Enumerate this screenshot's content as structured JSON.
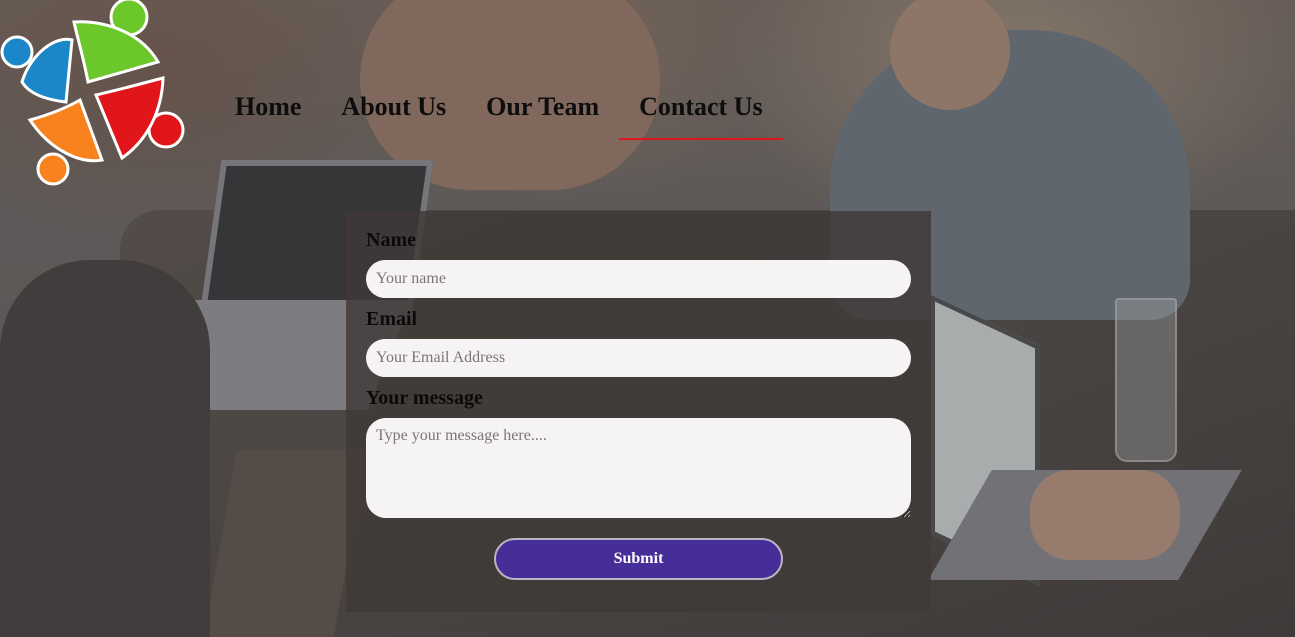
{
  "nav": {
    "items": [
      {
        "label": "Home",
        "active": false
      },
      {
        "label": "About Us",
        "active": false
      },
      {
        "label": "Our Team",
        "active": false
      },
      {
        "label": "Contact Us",
        "active": true
      }
    ],
    "active_underline_color": "#e0161b"
  },
  "logo": {
    "icon": "people-circle-logo-icon",
    "colors": [
      "#1b86c8",
      "#6cc72b",
      "#e0161b",
      "#f7821e"
    ]
  },
  "form": {
    "name_label": "Name",
    "name_placeholder": "Your name",
    "email_label": "Email",
    "email_placeholder": "Your Email Address",
    "message_label": "Your message",
    "message_placeholder": "Type your message here....",
    "submit_label": "Submit",
    "submit_color": "#472d97"
  }
}
